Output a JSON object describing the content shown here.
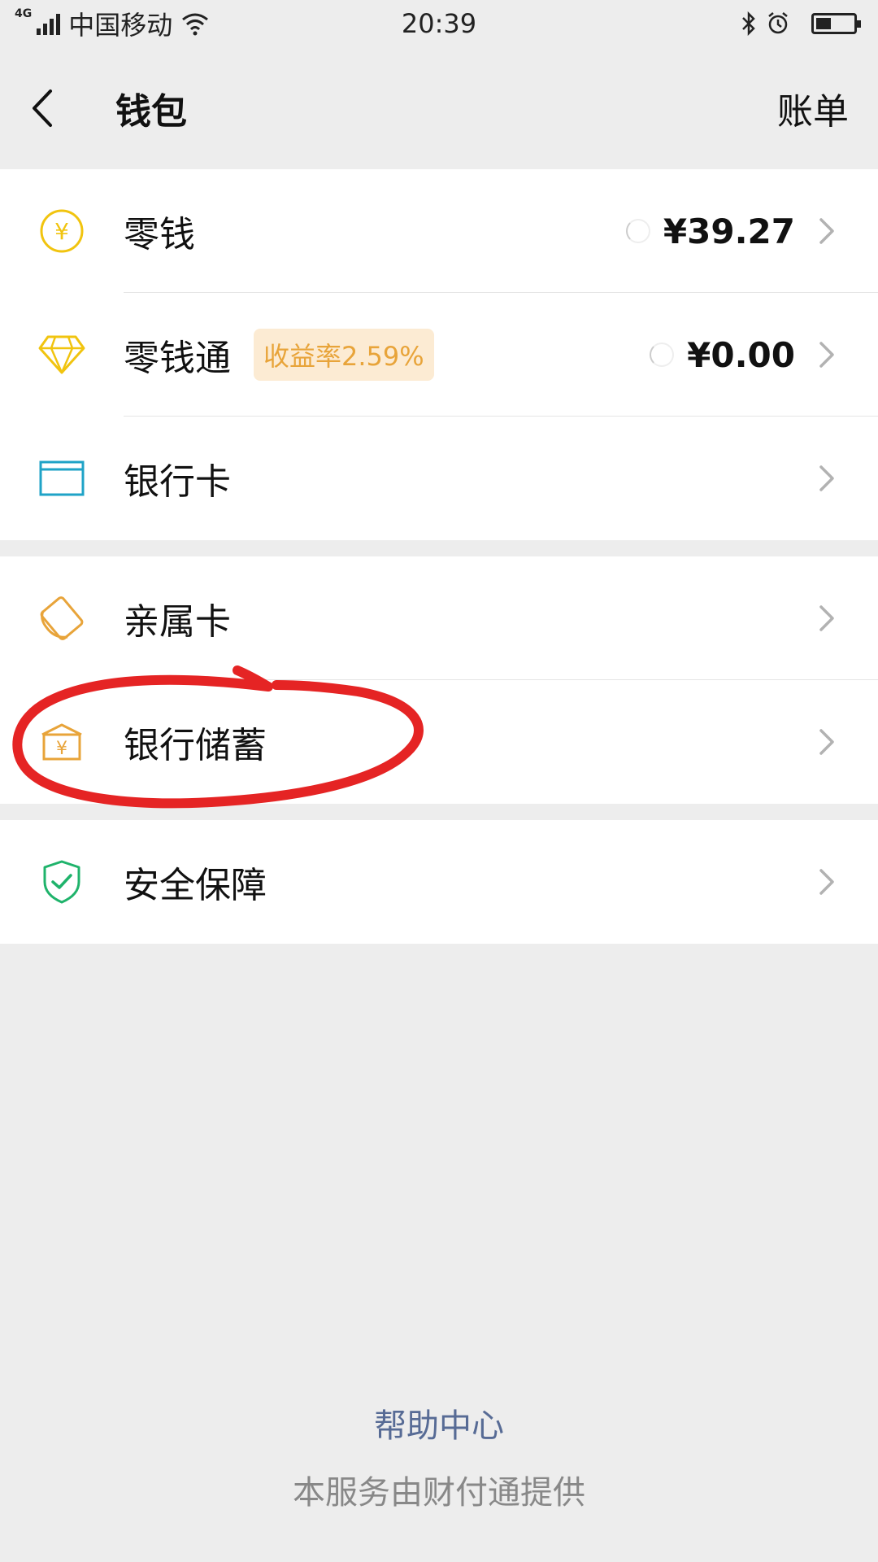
{
  "status_bar": {
    "network_type": "4G",
    "carrier": "中国移动",
    "time": "20:39",
    "icons": [
      "signal-icon",
      "wifi-icon",
      "bluetooth-icon",
      "alarm-icon",
      "battery-icon"
    ],
    "battery_level_percent": 40
  },
  "nav": {
    "title": "钱包",
    "right_label": "账单"
  },
  "groups": [
    {
      "items": [
        {
          "label": "零钱",
          "value": "¥39.27",
          "icon": "coin-yen-icon"
        },
        {
          "label": "零钱通",
          "badge": "收益率2.59%",
          "value": "¥0.00",
          "icon": "diamond-icon"
        },
        {
          "label": "银行卡",
          "icon": "bank-card-icon"
        }
      ]
    },
    {
      "items": [
        {
          "label": "亲属卡",
          "icon": "family-card-icon"
        },
        {
          "label": "银行储蓄",
          "icon": "bank-savings-icon"
        }
      ]
    },
    {
      "items": [
        {
          "label": "安全保障",
          "icon": "shield-check-icon"
        }
      ]
    }
  ],
  "footer": {
    "help_link": "帮助中心",
    "provider_note": "本服务由财付通提供"
  },
  "colors": {
    "background": "#ededed",
    "coin_yellow": "#f1c40f",
    "bank_card_blue": "#1fa3c7",
    "orange": "#e8a43a",
    "shield_green": "#1fb36b",
    "badge_bg": "#fcebd3",
    "link_blue": "#576b95",
    "annotation_red": "#e52424"
  }
}
